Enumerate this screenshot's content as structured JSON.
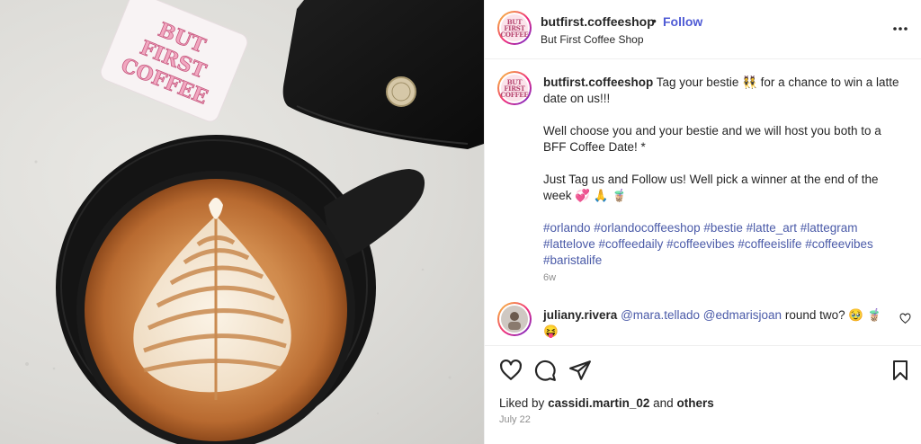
{
  "post": {
    "username": "butfirst.coffeeshop",
    "dot": "•",
    "follow_label": "Follow",
    "subtitle": "But First Coffee Shop",
    "avatar_logo_text": "BUT FIRST COFFEE"
  },
  "photo": {
    "sticker_text": "BUT FIRST COFFEE"
  },
  "caption": {
    "username": "butfirst.coffeeshop",
    "line1": "Tag your bestie 👯 for a chance to win a latte date on us!!!",
    "line2": "Well choose you and your bestie and we will host you both to a BFF Coffee Date! *",
    "line3": "Just Tag us and Follow us! Well pick a winner at the end of the week 💞 🙏 🧋",
    "hashtags": "#orlando #orlandocoffeeshop #bestie #latte_art #lattegram #lattelove #coffeedaily #coffeevibes #coffeeislife #coffeevibes #baristalife",
    "time": "6w"
  },
  "comment": {
    "username": "juliany.rivera",
    "mentions": "@mara.tellado @edmarisjoan",
    "text": "round two? 🥹 🧋 😝"
  },
  "footer": {
    "liked_prefix": "Liked by",
    "liked_user": "cassidi.martin_02",
    "liked_and": "and",
    "liked_others": "others",
    "date": "July 22"
  },
  "icons": {
    "more": "more-horizontal-icon",
    "like": "heart-icon",
    "comment": "comment-icon",
    "share": "paper-plane-icon",
    "save": "bookmark-icon"
  },
  "colors": {
    "link": "#4f5bd5",
    "hashtag": "#4a5aa8",
    "muted": "#8e8e8e"
  }
}
